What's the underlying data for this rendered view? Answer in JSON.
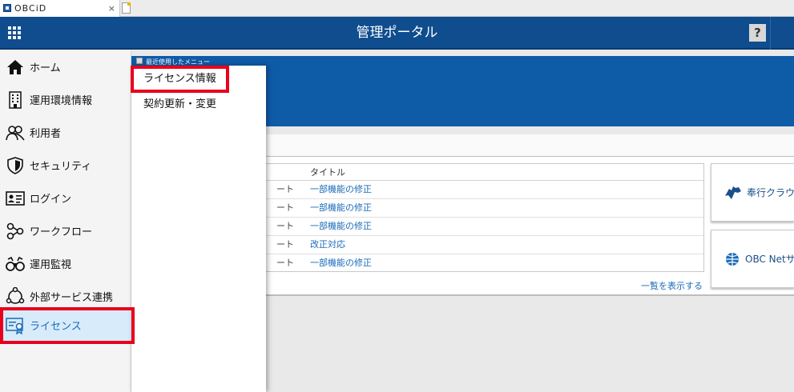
{
  "browser": {
    "tab_title": "OBCiD",
    "tab_close": "×"
  },
  "header": {
    "title": "管理ポータル",
    "help": "?"
  },
  "sidebar": {
    "items": [
      {
        "label": "ホーム",
        "icon": "home-icon"
      },
      {
        "label": "運用環境情報",
        "icon": "building-icon"
      },
      {
        "label": "利用者",
        "icon": "users-icon"
      },
      {
        "label": "セキュリティ",
        "icon": "shield-icon"
      },
      {
        "label": "ログイン",
        "icon": "id-card-icon"
      },
      {
        "label": "ワークフロー",
        "icon": "workflow-icon"
      },
      {
        "label": "運用監視",
        "icon": "binoculars-icon"
      },
      {
        "label": "外部サービス連携",
        "icon": "network-icon"
      },
      {
        "label": "ライセンス",
        "icon": "certificate-icon"
      }
    ],
    "active_index": 8
  },
  "submenu": {
    "items": [
      {
        "label": "ライセンス情報"
      },
      {
        "label": "契約更新・変更"
      }
    ]
  },
  "banner": {
    "strip_text": "最近使用したメニュー"
  },
  "news": {
    "header_title": "タイトル",
    "rows": [
      {
        "type": "ート",
        "title": "一部機能の修正"
      },
      {
        "type": "ート",
        "title": "一部機能の修正"
      },
      {
        "type": "ート",
        "title": "一部機能の修正"
      },
      {
        "type": "ート",
        "title": "改正対応"
      },
      {
        "type": "ート",
        "title": "一部機能の修正"
      }
    ],
    "more_link": "一覧を表示する"
  },
  "side_buttons": {
    "cloud": "奉行クラウ",
    "net": "OBC Netサ"
  },
  "colors": {
    "header_bg": "#0f4d8f",
    "banner_bg": "#0e5ba8",
    "active_bg": "#d7ebfa",
    "link": "#1a6bb8",
    "highlight": "#e8001c"
  }
}
